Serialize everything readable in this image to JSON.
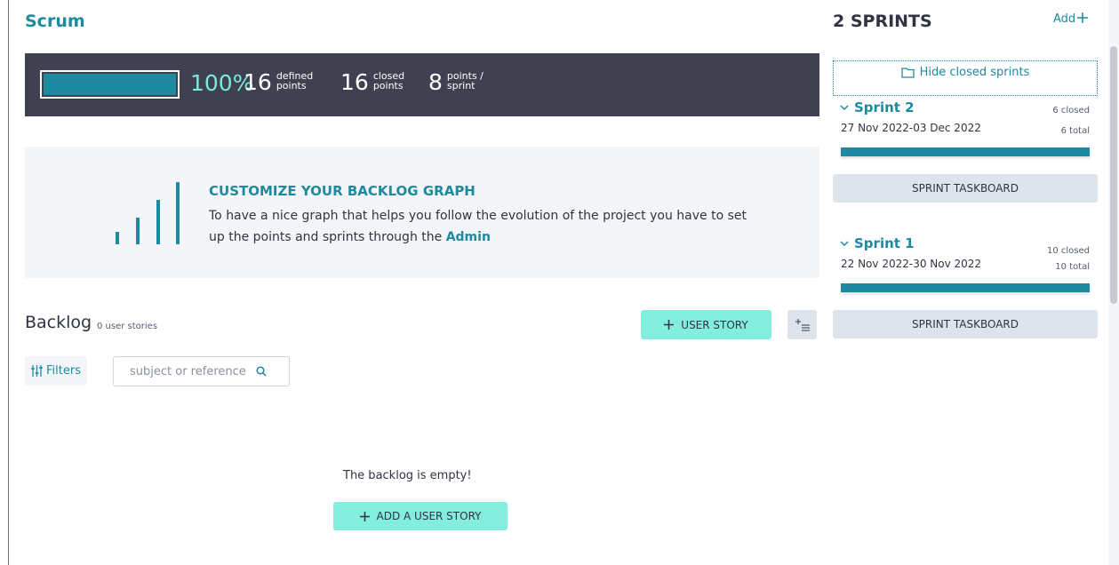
{
  "project": {
    "title": "Scrum"
  },
  "summary": {
    "progress_pct_text": "100%",
    "progress_fraction": 1.0,
    "defined": {
      "value": "16",
      "label_1": "defined",
      "label_2": "points"
    },
    "closed": {
      "value": "16",
      "label_1": "closed",
      "label_2": "points"
    },
    "per_sprint": {
      "value": "8",
      "label_1": "points /",
      "label_2": "sprint"
    }
  },
  "graph_panel": {
    "title": "CUSTOMIZE YOUR BACKLOG GRAPH",
    "text_before": "To have a nice graph that helps you follow the evolution of the project you have to set up the points and sprints through the ",
    "admin_link": "Admin"
  },
  "backlog": {
    "title": "Backlog",
    "count": "0 user stories",
    "user_story_button": "USER STORY",
    "filters_label": "Filters",
    "search_placeholder": "subject or reference",
    "empty_message": "The backlog is empty!",
    "add_story_button": "ADD A USER STORY"
  },
  "sidebar": {
    "title": "2 SPRINTS",
    "add_label": "Add",
    "hide_closed_label": "Hide closed sprints",
    "sprints": [
      {
        "name": "Sprint 2",
        "closed": "6 closed",
        "dates": "27 Nov 2022-03 Dec 2022",
        "total": "6 total",
        "progress": 1.0,
        "taskboard_label": "SPRINT TASKBOARD"
      },
      {
        "name": "Sprint 1",
        "closed": "10 closed",
        "dates": "22 Nov 2022-30 Nov 2022",
        "total": "10 total",
        "progress": 1.0,
        "taskboard_label": "SPRINT TASKBOARD"
      }
    ]
  },
  "colors": {
    "accent": "#1e8aa0",
    "mint": "#83eede",
    "dark_bar": "#3f4150",
    "panel": "#f4f5f9"
  }
}
